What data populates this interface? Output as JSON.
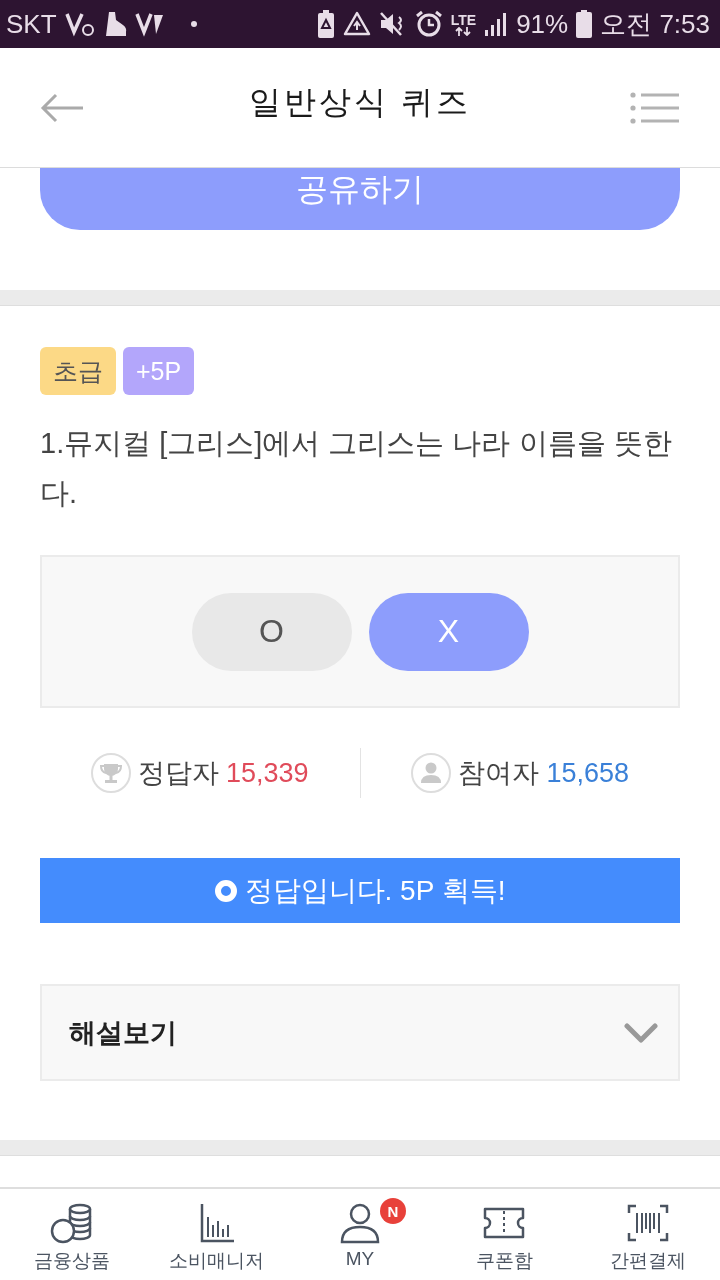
{
  "status_bar": {
    "carrier": "SKT",
    "network": "LTE",
    "battery": "91%",
    "time": "오전 7:53"
  },
  "header": {
    "title": "일반상식 퀴즈"
  },
  "share_button": {
    "label": "공유하기"
  },
  "quiz": {
    "tags": [
      {
        "label": "초급",
        "color": "#fcd986"
      },
      {
        "label": "+5P",
        "color": "#b3a6fb"
      }
    ],
    "question": "1.뮤지컬 [그리스]에서 그리스는 나라 이름을 뜻한다.",
    "options": [
      {
        "label": "O",
        "selected": false
      },
      {
        "label": "X",
        "selected": true
      }
    ],
    "stats": [
      {
        "label": "정답자",
        "value": "15,339",
        "color": "#e04b5a"
      },
      {
        "label": "참여자",
        "value": "15,658",
        "color": "#3a80d8"
      }
    ],
    "result_banner": {
      "text": "정답입니다. 5P 획득!"
    },
    "explanation": {
      "label": "해설보기",
      "expanded": false
    }
  },
  "bottom_nav": [
    {
      "label": "금융상품"
    },
    {
      "label": "소비매니저"
    },
    {
      "label": "MY",
      "badge": "N"
    },
    {
      "label": "쿠폰함"
    },
    {
      "label": "간편결제"
    }
  ]
}
